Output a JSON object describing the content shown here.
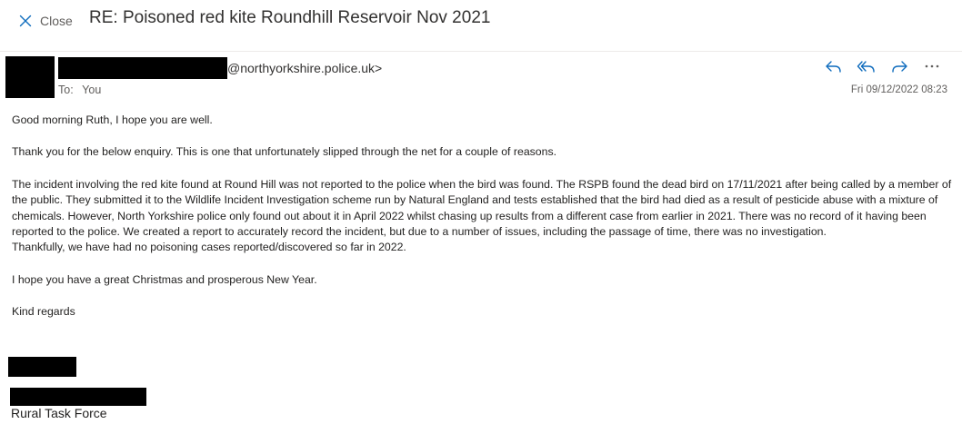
{
  "header": {
    "close_label": "Close",
    "subject": "RE: Poisoned red kite Roundhill Reservoir Nov 2021"
  },
  "message": {
    "sender_domain": "@northyorkshire.police.uk>",
    "to_label": "To:",
    "to_value": "You",
    "date": "Fri 09/12/2022 08:23",
    "actions": [
      "reply-icon",
      "reply-all-icon",
      "forward-icon",
      "more-icon"
    ]
  },
  "body": {
    "greeting": "Good morning Ruth, I hope you are well.",
    "para1": "Thank you for the below enquiry. This is one that unfortunately slipped through the net for a couple of reasons.",
    "para2": "The incident involving the red kite found at Round Hill was not reported to the police when the bird was found.  The RSPB found the dead bird on 17/11/2021 after being called by a member of the public.  They submitted it to the Wildlife Incident Investigation scheme run by Natural England and tests established that the bird had died as a result of pesticide abuse with a mixture of chemicals. However, North Yorkshire police only found out about it in April 2022 whilst chasing up results from a different case from earlier in 2021.  There was no record of it having been reported to the police. We created a report to accurately record the incident, but due to a number of issues, including the passage of time, there was no investigation.",
    "para3": "Thankfully, we have had no poisoning cases reported/discovered so far in 2022.",
    "para4": "I hope you have a great Christmas and prosperous New Year.",
    "signoff": "Kind regards",
    "signature_org": "Rural Task Force"
  },
  "colors": {
    "accent": "#0f6cbd",
    "text": "#201f1e",
    "muted": "#605e5c"
  }
}
